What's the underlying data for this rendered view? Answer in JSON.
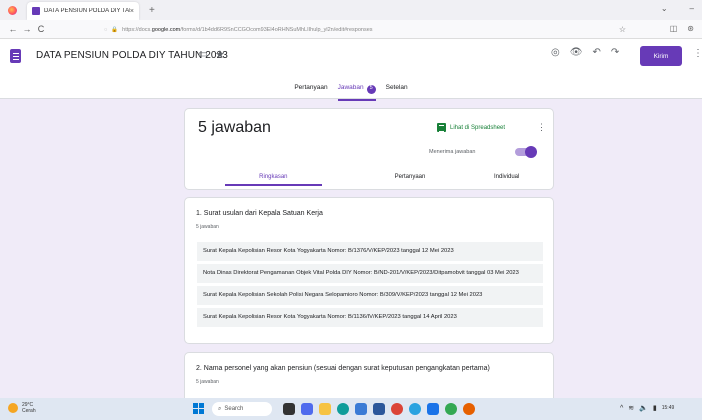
{
  "browser": {
    "tab_title": "DATA PENSIUN POLDA DIY TAH",
    "tab_close": "×",
    "new_tab": "+",
    "url_prefix": "https://docs.",
    "url_domain": "google.com",
    "url_rest": "/forms/d/1b4dd6R9SnCCGOcom93El4oRHNSuMhLIIhulp_yl2n/edit#responses",
    "back": "←",
    "forward": "→",
    "reload": "C",
    "win_min": "–",
    "win_chevron": "⌄"
  },
  "form": {
    "title": "DATA PENSIUN POLDA DIY TAHUN 2023",
    "send_label": "Kirim",
    "tabs": [
      {
        "label": "Pertanyaan"
      },
      {
        "label": "Jawaban",
        "count": "5"
      },
      {
        "label": "Setelan"
      }
    ]
  },
  "summary": {
    "responses_title": "5 jawaban",
    "spreadsheet_label": "Lihat di Spreadsheet",
    "accepting_label": "Menerima jawaban",
    "accepting": true,
    "subtabs": [
      "Ringkasan",
      "Pertanyaan",
      "Individual"
    ]
  },
  "questions": [
    {
      "title": "1. Surat usulan dari Kepala Satuan Kerja",
      "count": "5 jawaban",
      "answers": [
        "Surat Kepala Kepolisian Resor Kota Yogyakarta Nomor: B/1376/V/KEP/2023 tanggal 12 Mei 2023",
        "Nota Dinas Direktorat Pengamanan Objek Vital Polda DIY Nomor: B/ND-201/V/KEP/2023/Ditpamobvit tanggal 03 Mei 2023",
        "Surat Kepala Kepolisian Sekolah Polisi Negara Selopamioro Nomor: B/309/V/KEP/2023 tanggal 12 Mei 2023",
        "Surat Kepala Kepolisian Resor Kota Yogyakarta Nomor: B/1136/IV/KEP/2023 tanggal 14 April 2023"
      ]
    },
    {
      "title": "2. Nama personel yang akan pensiun (sesuai dengan surat keputusan pengangkatan pertama)",
      "count": "5 jawaban"
    }
  ],
  "taskbar": {
    "weather_temp": "29°C",
    "weather_desc": "Cerah",
    "search_placeholder": "Search",
    "time": "15:49"
  }
}
